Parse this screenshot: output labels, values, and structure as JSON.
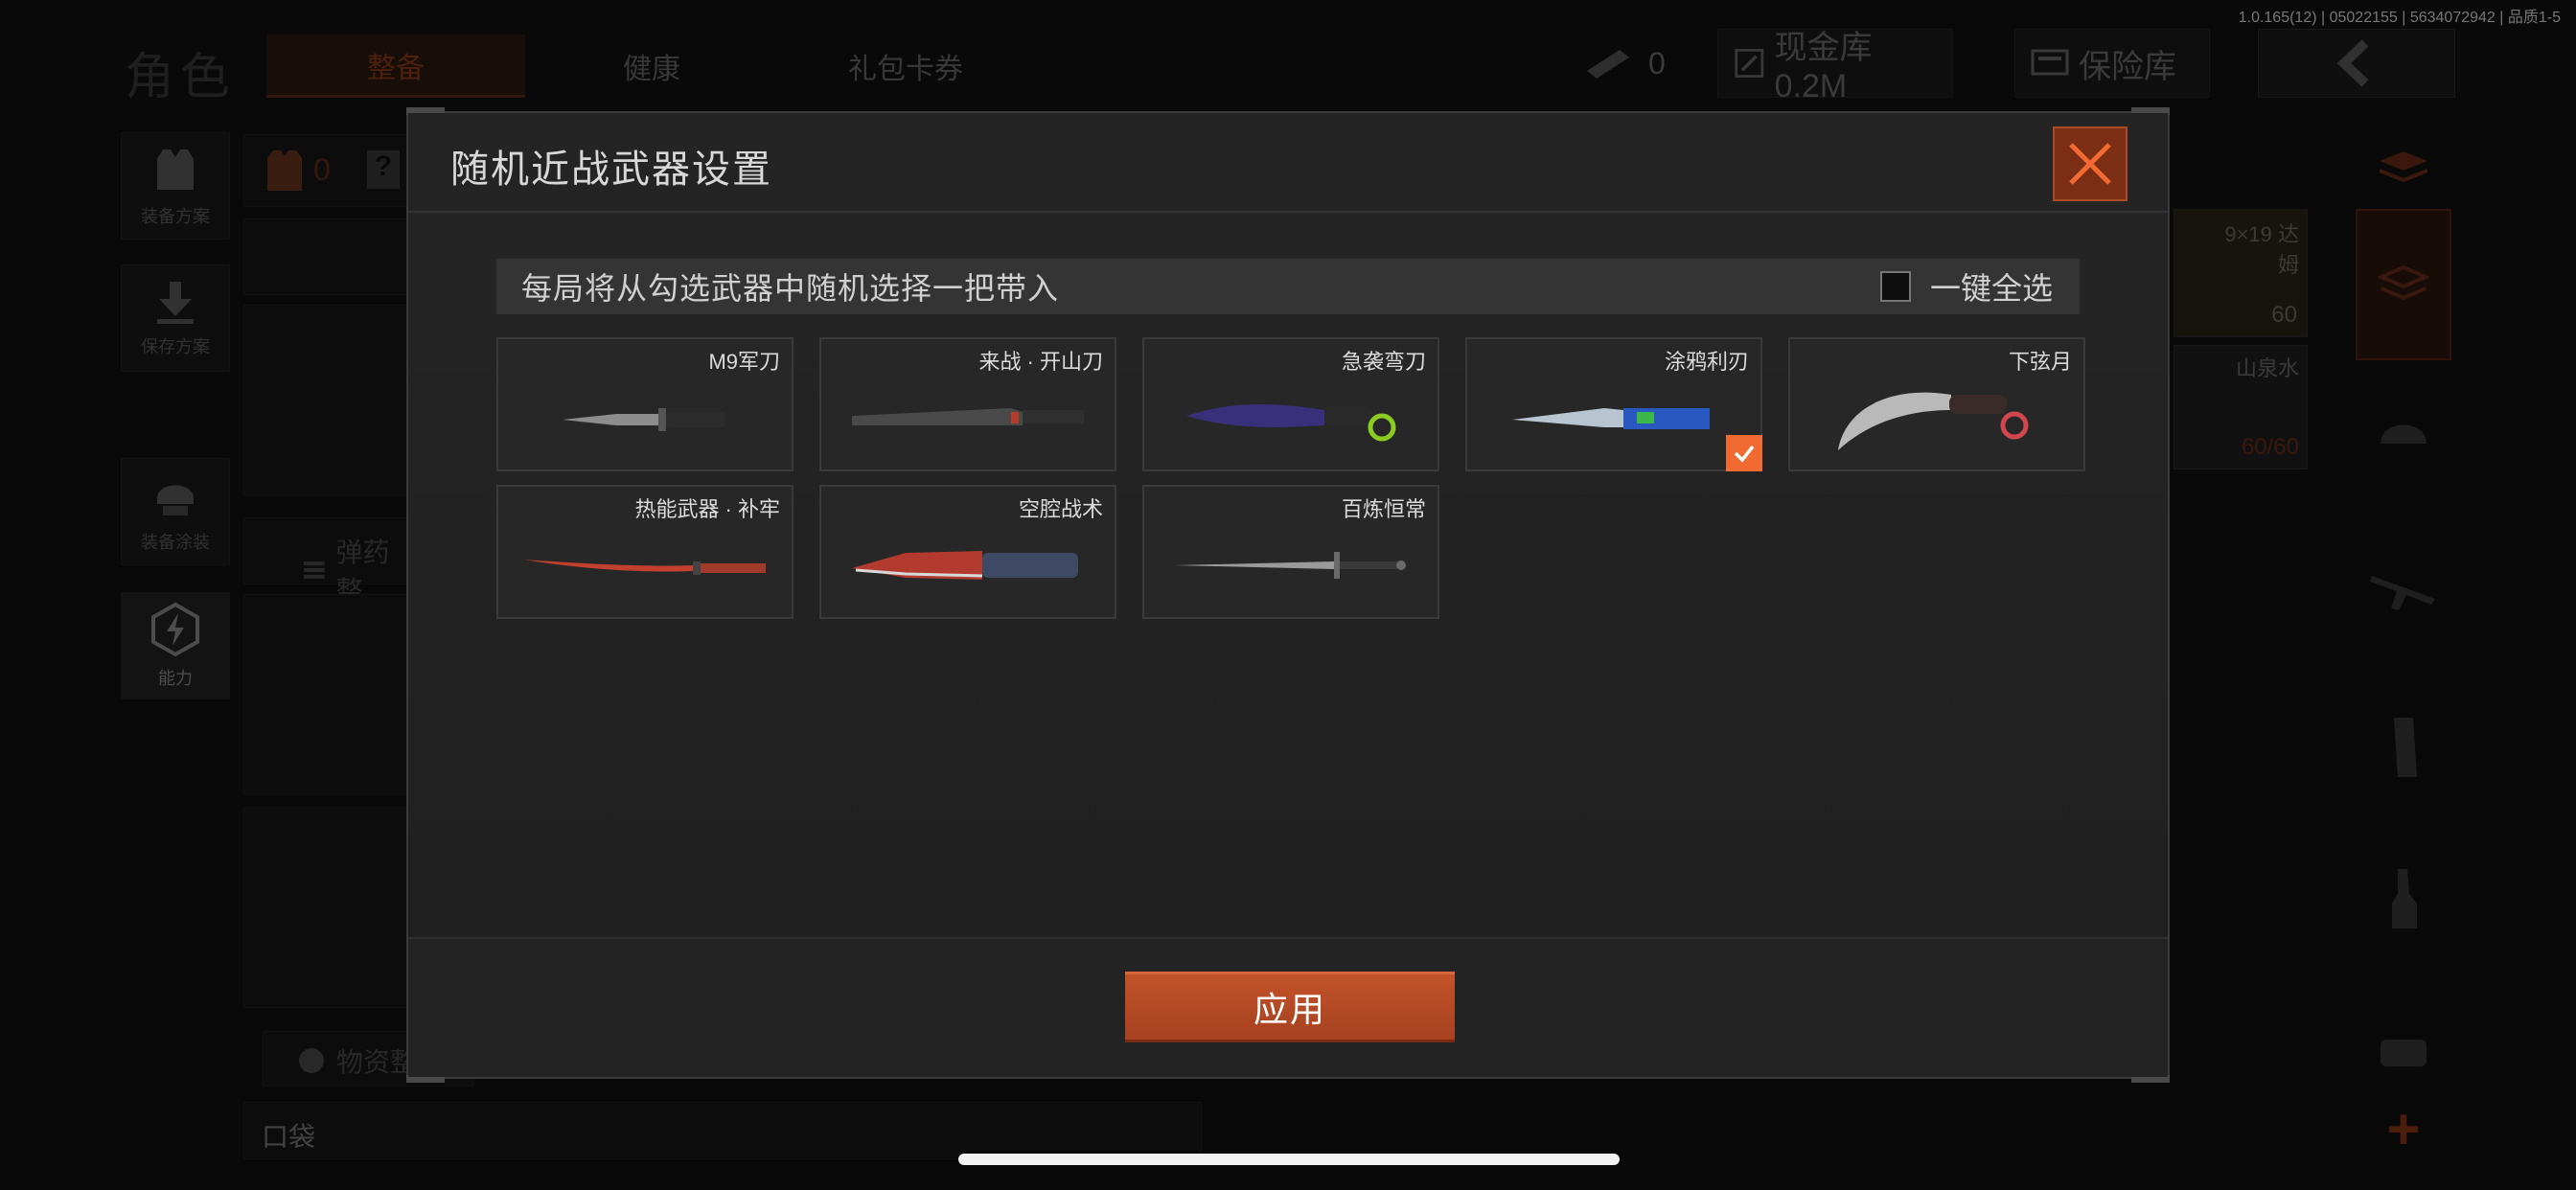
{
  "status": {
    "build": "1.0.165(12) | 05022155 | 5634072942 | 品质1-5"
  },
  "header": {
    "title": "角色",
    "tabs": [
      {
        "label": "整备",
        "active": true
      },
      {
        "label": "健康",
        "active": false
      },
      {
        "label": "礼包卡券",
        "active": false
      }
    ],
    "currency_count": "0",
    "cash_vault": "现金库 0.2M",
    "safe_box": "保险库"
  },
  "sidebar": {
    "items": [
      {
        "label": "装备方案",
        "icon": "vest-icon"
      },
      {
        "label": "保存方案",
        "icon": "download-icon"
      },
      {
        "label": "装备涂装",
        "icon": "helmet-icon"
      },
      {
        "label": "能力",
        "icon": "ability-icon"
      }
    ]
  },
  "loadout": {
    "armor_count": "0",
    "help": "?",
    "ammo_label": "弹药整",
    "supplies_label": "物资整",
    "pocket_label": "口袋"
  },
  "right_panel": {
    "ammo_name": "9×19 达姆",
    "ammo_count": "60",
    "water_name": "山泉水",
    "water_count": "60/60",
    "add": "+"
  },
  "modal": {
    "title": "随机近战武器设置",
    "info": "每局将从勾选武器中随机选择一把带入",
    "select_all": "一键全选",
    "select_all_checked": false,
    "apply": "应用",
    "accent_color": "#f06a32",
    "weapons": [
      {
        "name": "M9军刀",
        "checked": false
      },
      {
        "name": "来战 · 开山刀",
        "checked": false
      },
      {
        "name": "急袭弯刀",
        "checked": false
      },
      {
        "name": "涂鸦利刃",
        "checked": true
      },
      {
        "name": "下弦月",
        "checked": false
      },
      {
        "name": "热能武器 · 补牢",
        "checked": false
      },
      {
        "name": "空腔战术",
        "checked": false
      },
      {
        "name": "百炼恒常",
        "checked": false
      }
    ]
  }
}
